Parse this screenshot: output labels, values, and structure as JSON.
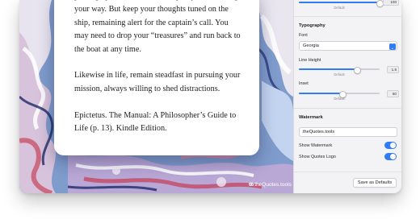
{
  "quote": {
    "paragraph_1": "picking up some seashells and pretty stones along your way. But keep your thoughts tuned on the ship, remaining alert for the captain’s call. You may need to drop your “treasures” and run back to the boat at any time.",
    "paragraph_2": "Likewise in life, remain steadfast in pursuing your mission, always willing to shed distractions.",
    "attribution": "Epictetus. The Manual: A Philosopher’s Guide to Life (p. 13). Kindle Edition."
  },
  "canvas_watermark": {
    "logo": "66",
    "text": "theQuotes.tools"
  },
  "sidebar": {
    "top_slider": {
      "value": "100",
      "reset_label": "Default",
      "level_percent": 100
    },
    "typography": {
      "title": "Typography",
      "font_label": "Font",
      "font_value": "Georgia",
      "line_height_label": "Line Height",
      "line_height_value": "1.6",
      "line_height_reset": "Default",
      "line_height_percent": 72,
      "inset_label": "Inset",
      "inset_value": "60",
      "inset_reset": "Default",
      "inset_percent": 54
    },
    "watermark": {
      "title": "Watermark",
      "text_value": "theQuotes.tools",
      "show_watermark_label": "Show Watermark",
      "show_watermark_on": true,
      "show_logo_label": "Show Quotes Logo",
      "show_logo_on": true
    },
    "save_button": "Save as Defaults"
  },
  "colors": {
    "accent": "#2f7cf6",
    "panel": "#f3f3f5"
  }
}
